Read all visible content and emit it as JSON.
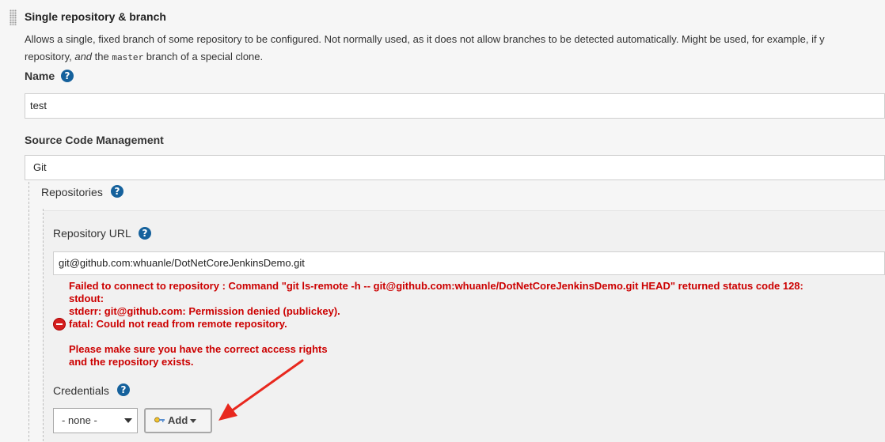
{
  "section": {
    "title": "Single repository & branch",
    "description_parts": {
      "p1": "Allows a single, fixed branch of some repository to be configured. Not normally used, as it does not allow branches to be detected automatically. Might be used, for example, if y",
      "p2": "repository, ",
      "p3_italic": "and",
      "p4": " the ",
      "p5_mono": "master",
      "p6": " branch of a special clone."
    }
  },
  "name": {
    "label": "Name",
    "value": "test"
  },
  "scm": {
    "label": "Source Code Management",
    "value": "Git"
  },
  "repositories": {
    "label": "Repositories"
  },
  "repository_url": {
    "label": "Repository URL",
    "value": "git@github.com:whuanle/DotNetCoreJenkinsDemo.git"
  },
  "error": {
    "line1": "Failed to connect to repository : Command \"git ls-remote -h -- git@github.com:whuanle/DotNetCoreJenkinsDemo.git HEAD\" returned status code 128:",
    "line2": "stdout:",
    "line3": "stderr: git@github.com: Permission denied (publickey).",
    "line4": "fatal: Could not read from remote repository.",
    "line5": "",
    "line6": "Please make sure you have the correct access rights",
    "line7": "and the repository exists."
  },
  "credentials": {
    "label": "Credentials",
    "selected": "- none -",
    "add_button_label": "Add"
  },
  "help_icon_text": "?",
  "colors": {
    "error": "#cc0000",
    "help_icon": "#15619c",
    "annotation_arrow": "#e8281e"
  },
  "icons": [
    "drag-handle-icon",
    "help-icon",
    "error-icon",
    "key-icon",
    "caret-down-icon",
    "annotation-arrow"
  ]
}
